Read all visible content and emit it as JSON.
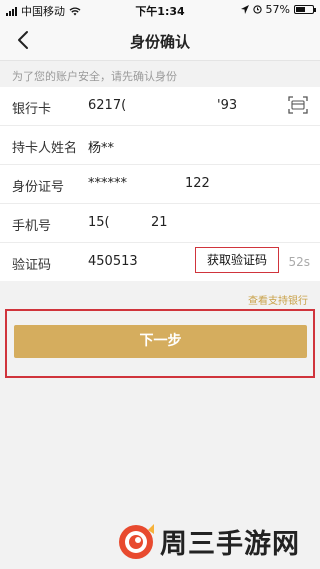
{
  "status_bar": {
    "carrier": "中国移动",
    "time": "下午1:34",
    "battery_percent": "57%",
    "battery_level": 0.57
  },
  "nav": {
    "title": "身份确认"
  },
  "notice": "为了您的账户安全，请先确认身份",
  "form": {
    "bank_card": {
      "label": "银行卡",
      "value_start": "6217(",
      "value_end": "'93"
    },
    "holder": {
      "label": "持卡人姓名",
      "value": "杨**"
    },
    "id_number": {
      "label": "身份证号",
      "value_start": "******",
      "value_end": "122"
    },
    "phone": {
      "label": "手机号",
      "value_start": "15(",
      "value_end": "21"
    },
    "sms_code": {
      "label": "验证码",
      "value": "450513",
      "button": "获取验证码",
      "countdown": "52s"
    }
  },
  "support_link": "查看支持银行",
  "next_button": "下一步",
  "watermark": {
    "text": "周三手游网"
  },
  "colors": {
    "accent": "#d5ad5e",
    "highlight_frame": "#d0343c",
    "link": "#c9a24a"
  }
}
